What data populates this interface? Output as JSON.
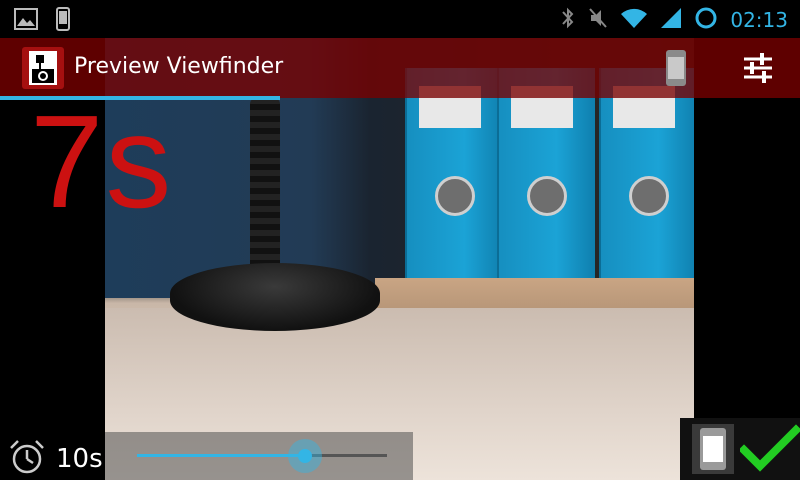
{
  "status_bar": {
    "time": "02:13",
    "icons": [
      "gallery-icon",
      "phone-icon",
      "bluetooth-icon",
      "muted-icon",
      "wifi-icon",
      "signal-icon",
      "sync-icon"
    ]
  },
  "app_bar": {
    "title": "Preview Viewfinder",
    "actions": [
      "watch-icon",
      "settings-sliders-icon"
    ],
    "progress": 0.35
  },
  "countdown": "7s",
  "timer": {
    "value": "10s",
    "icon": "alarm-clock-icon",
    "slider_fraction": 0.67
  },
  "bottom_actions": [
    "watch-icon",
    "checkmark-icon"
  ],
  "colors": {
    "accent": "#33b5e5",
    "app_bar": "#7a0000",
    "countdown": "#cc1111",
    "confirm": "#22cc22"
  }
}
